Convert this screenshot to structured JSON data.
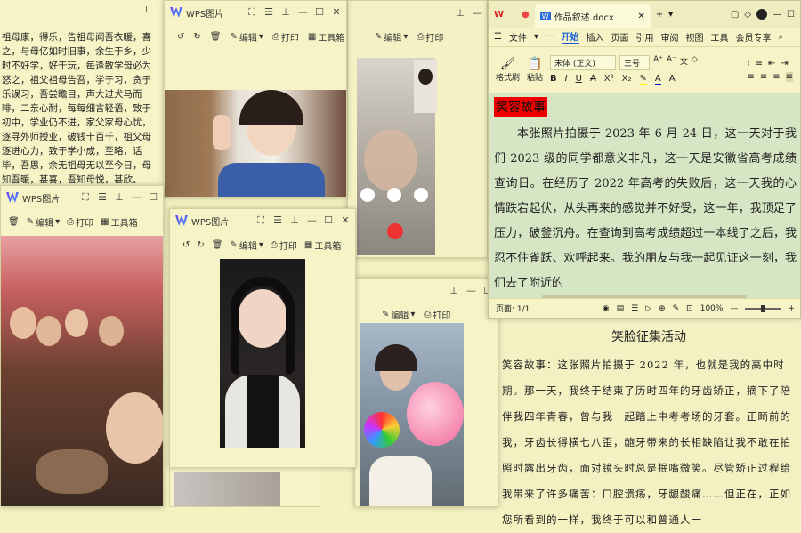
{
  "left_document": {
    "text": "祖母康，得乐，告祖母闻吾衣暖，喜之，与母亿如时旧事，余生于乡，少时不好学，好于玩，每逢散学母必为怒之，祖父祖母告吾，学于习，贪于乐误习，吾尝瞻目，声大过犬马而啡，二亲心耐，每每细言轻语，致于初中，学业仍不进，家父家母心忧，逐寻外师授业，破钱十百千，祖父母逐进心力，致于学小成，至略，话毕，吾思，余无祖母无以至今日，母知吾暖，甚喜，吾知母悦，甚欣。"
  },
  "viewer": {
    "title": "WPS图片",
    "edit": "编辑",
    "print": "打印",
    "toolbox": "工具箱"
  },
  "word": {
    "tab_title": "作品叙述.docx",
    "file_menu": "文件",
    "menus": [
      "开始",
      "插入",
      "页面",
      "引用",
      "审阅",
      "视图",
      "工具",
      "会员专享"
    ],
    "ribbon": {
      "format_painter": "格式刷",
      "paste": "粘贴",
      "font": "宋体 (正文)",
      "size": "三号"
    },
    "heading": "笑容故事",
    "paragraph": "本张照片拍摄于 2023 年 6 月 24 日，这一天对于我们 2023 级的同学都意义非凡，这一天是安徽省高考成绩查询日。在经历了 2022 年高考的失败后，这一天我的心情跌宕起伏，从头再来的感觉并不好受，这一年，我顶足了压力，破釜沉舟。在查询到高考成绩超过一本线了之后，我忍不住雀跃、欢呼起来。我的朋友与我一起见证这一刻，我们去了附近的",
    "page_status": "页面: 1/1",
    "zoom": "100%"
  },
  "doc2": {
    "title": "笑脸征集活动",
    "text": "笑容故事：这张照片拍摄于 2022 年，也就是我的高中时期。那一天，我终于结束了历时四年的牙齿矫正，摘下了陪伴我四年青春，曾与我一起踏上中考考场的牙套。正畸前的我，牙齿长得横七八歪，龅牙带来的长相缺陷让我不敢在拍照时露出牙齿，面对镜头时总是抿嘴微笑。尽管矫正过程给我带来了许多痛苦：口腔溃疡，牙龈酸痛……但正在，正如您所看到的一样，我终于可以和普通人一"
  }
}
